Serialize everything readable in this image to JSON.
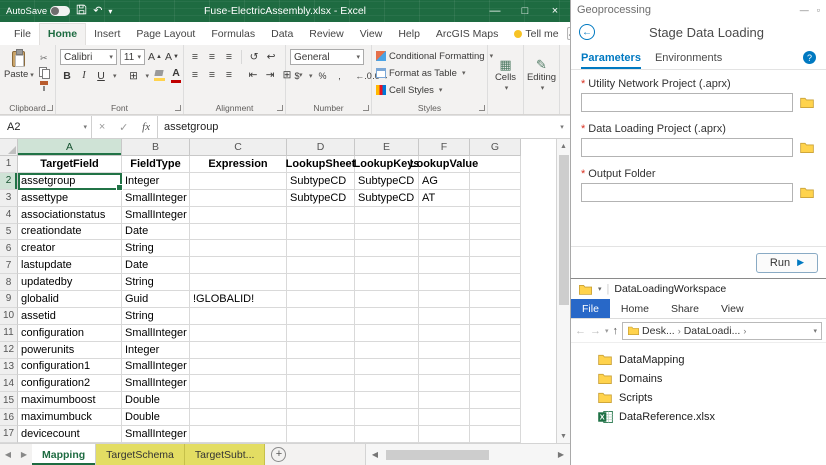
{
  "colors": {
    "excel_green": "#217346",
    "esri_blue": "#0079c1",
    "explorer_file_blue": "#2868c8",
    "sheet_tab_yellow": "#e3dd63",
    "required_red": "#d83020"
  },
  "excel": {
    "titlebar": {
      "autosave_label": "AutoSave",
      "title": "Fuse-ElectricAssembly.xlsx - Excel"
    },
    "ribbon_tabs": [
      {
        "label": "File"
      },
      {
        "label": "Home",
        "active": true
      },
      {
        "label": "Insert"
      },
      {
        "label": "Page Layout"
      },
      {
        "label": "Formulas"
      },
      {
        "label": "Data"
      },
      {
        "label": "Review"
      },
      {
        "label": "View"
      },
      {
        "label": "Help"
      },
      {
        "label": "ArcGIS Maps"
      },
      {
        "label": "Tell me",
        "bulb": true
      }
    ],
    "ribbon": {
      "paste_label": "Paste",
      "font_name": "Calibri",
      "font_size": "11",
      "number_format": "General",
      "styles": [
        "Conditional Formatting",
        "Format as Table",
        "Cell Styles"
      ],
      "cells_label": "Cells",
      "editing_label": "Editing",
      "group_labels": [
        "Clipboard",
        "Font",
        "Alignment",
        "Number",
        "Styles"
      ]
    },
    "formula": {
      "name_box": "A2",
      "fx_label": "fx",
      "value": "assetgroup"
    },
    "grid": {
      "columns": [
        "A",
        "B",
        "C",
        "D",
        "E",
        "F",
        "G"
      ],
      "selection": "A2",
      "rows": [
        [
          "TargetField",
          "FieldType",
          "Expression",
          "LookupSheet",
          "LookupKeys",
          "LookupValue",
          ""
        ],
        [
          "assetgroup",
          "Integer",
          "",
          "SubtypeCD",
          "SubtypeCD",
          "AG",
          ""
        ],
        [
          "assettype",
          "SmallInteger",
          "",
          "SubtypeCD",
          "SubtypeCD",
          "AT",
          ""
        ],
        [
          "associationstatus",
          "SmallInteger",
          "",
          "",
          "",
          "",
          ""
        ],
        [
          "creationdate",
          "Date",
          "",
          "",
          "",
          "",
          ""
        ],
        [
          "creator",
          "String",
          "",
          "",
          "",
          "",
          ""
        ],
        [
          "lastupdate",
          "Date",
          "",
          "",
          "",
          "",
          ""
        ],
        [
          "updatedby",
          "String",
          "",
          "",
          "",
          "",
          ""
        ],
        [
          "globalid",
          "Guid",
          "!GLOBALID!",
          "",
          "",
          "",
          ""
        ],
        [
          "assetid",
          "String",
          "",
          "",
          "",
          "",
          ""
        ],
        [
          "configuration",
          "SmallInteger",
          "",
          "",
          "",
          "",
          ""
        ],
        [
          "powerunits",
          "Integer",
          "",
          "",
          "",
          "",
          ""
        ],
        [
          "configuration1",
          "SmallInteger",
          "",
          "",
          "",
          "",
          ""
        ],
        [
          "configuration2",
          "SmallInteger",
          "",
          "",
          "",
          "",
          ""
        ],
        [
          "maximumboost",
          "Double",
          "",
          "",
          "",
          "",
          ""
        ],
        [
          "maximumbuck",
          "Double",
          "",
          "",
          "",
          "",
          ""
        ],
        [
          "devicecount",
          "SmallInteger",
          "",
          "",
          "",
          "",
          ""
        ]
      ]
    },
    "sheet_tabs": [
      {
        "label": "Mapping",
        "active": true
      },
      {
        "label": "TargetSchema",
        "color": "yellow"
      },
      {
        "label": "TargetSubt...",
        "color": "yellow"
      }
    ]
  },
  "geoprocessing": {
    "panel_title": "Geoprocessing",
    "tool_title": "Stage Data Loading",
    "tabs": [
      {
        "label": "Parameters",
        "active": true
      },
      {
        "label": "Environments"
      }
    ],
    "help_label": "?",
    "fields": [
      {
        "label": "Utility Network Project (.aprx)",
        "required": true,
        "value": ""
      },
      {
        "label": "Data Loading Project (.aprx)",
        "required": true,
        "value": ""
      },
      {
        "label": "Output Folder",
        "required": true,
        "value": ""
      }
    ],
    "run_label": "Run"
  },
  "explorer": {
    "window_title": "DataLoadingWorkspace",
    "ribbon_tabs": [
      {
        "label": "File",
        "file": true
      },
      {
        "label": "Home"
      },
      {
        "label": "Share"
      },
      {
        "label": "View"
      }
    ],
    "breadcrumb": [
      "Desk...",
      "DataLoadi..."
    ],
    "items": [
      {
        "name": "DataMapping",
        "type": "folder"
      },
      {
        "name": "Domains",
        "type": "folder"
      },
      {
        "name": "Scripts",
        "type": "folder"
      },
      {
        "name": "DataReference.xlsx",
        "type": "excel"
      }
    ]
  }
}
